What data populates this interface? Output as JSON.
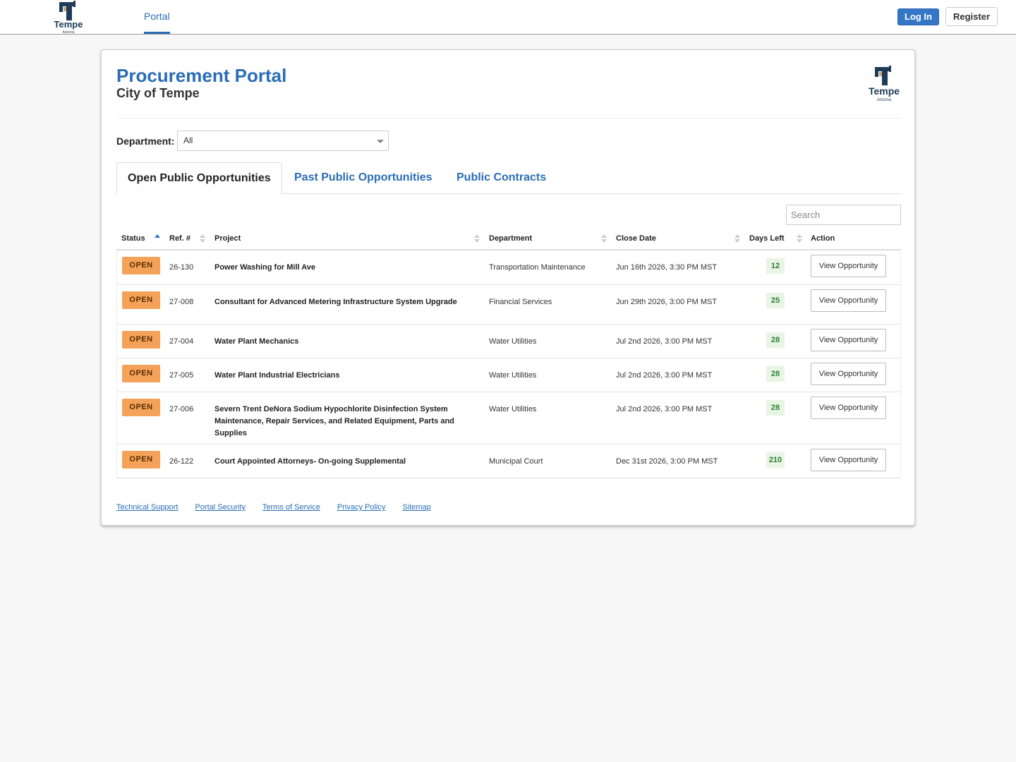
{
  "topnav": {
    "logo_text": "Tempe",
    "logo_sub": "Arizona",
    "portal_label": "Portal",
    "login_label": "Log In",
    "register_label": "Register"
  },
  "header": {
    "title": "Procurement Portal",
    "subtitle": "City of Tempe"
  },
  "filter": {
    "department_label": "Department:",
    "department_value": "All"
  },
  "tabs": [
    {
      "label": "Open Public Opportunities",
      "active": true
    },
    {
      "label": "Past Public Opportunities",
      "active": false
    },
    {
      "label": "Public Contracts",
      "active": false
    }
  ],
  "search": {
    "placeholder": "Search"
  },
  "table": {
    "columns": [
      "Status",
      "Ref. #",
      "Project",
      "Department",
      "Close Date",
      "Days Left",
      "Action"
    ],
    "sorted_column": "Status",
    "rows": [
      {
        "status": "OPEN",
        "ref": "26-130",
        "project": "Power Washing for Mill Ave",
        "department": "Transportation Maintenance",
        "close_date": "Jun 16th 2026, 3:30 PM MST",
        "days_left": "12",
        "action": "View Opportunity"
      },
      {
        "status": "OPEN",
        "ref": "27-008",
        "project": "Consultant for Advanced Metering Infrastructure System Upgrade",
        "department": "Financial Services",
        "close_date": "Jun 29th 2026, 3:00 PM MST",
        "days_left": "25",
        "action": "View Opportunity"
      },
      {
        "status": "OPEN",
        "ref": "27-004",
        "project": "Water Plant Mechanics",
        "department": "Water Utilities",
        "close_date": "Jul 2nd 2026, 3:00 PM MST",
        "days_left": "28",
        "action": "View Opportunity"
      },
      {
        "status": "OPEN",
        "ref": "27-005",
        "project": "Water Plant Industrial Electricians",
        "department": "Water Utilities",
        "close_date": "Jul 2nd 2026, 3:00 PM MST",
        "days_left": "28",
        "action": "View Opportunity"
      },
      {
        "status": "OPEN",
        "ref": "27-006",
        "project": "Severn Trent DeNora Sodium Hypochlorite Disinfection System Maintenance, Repair Services, and Related Equipment, Parts and Supplies",
        "department": "Water Utilities",
        "close_date": "Jul 2nd 2026, 3:00 PM MST",
        "days_left": "28",
        "action": "View Opportunity"
      },
      {
        "status": "OPEN",
        "ref": "26-122",
        "project": "Court Appointed Attorneys- On-going Supplemental",
        "department": "Municipal Court",
        "close_date": "Dec 31st 2026, 3:00 PM MST",
        "days_left": "210",
        "action": "View Opportunity"
      }
    ]
  },
  "footer": {
    "links": [
      "Technical Support",
      "Portal Security",
      "Terms of Service",
      "Privacy Policy",
      "Sitemap"
    ]
  },
  "colors": {
    "brand_blue": "#2a6db5",
    "open_badge": "#f4a259",
    "days_bg": "#e8f4e4",
    "days_text": "#2e7d32"
  }
}
